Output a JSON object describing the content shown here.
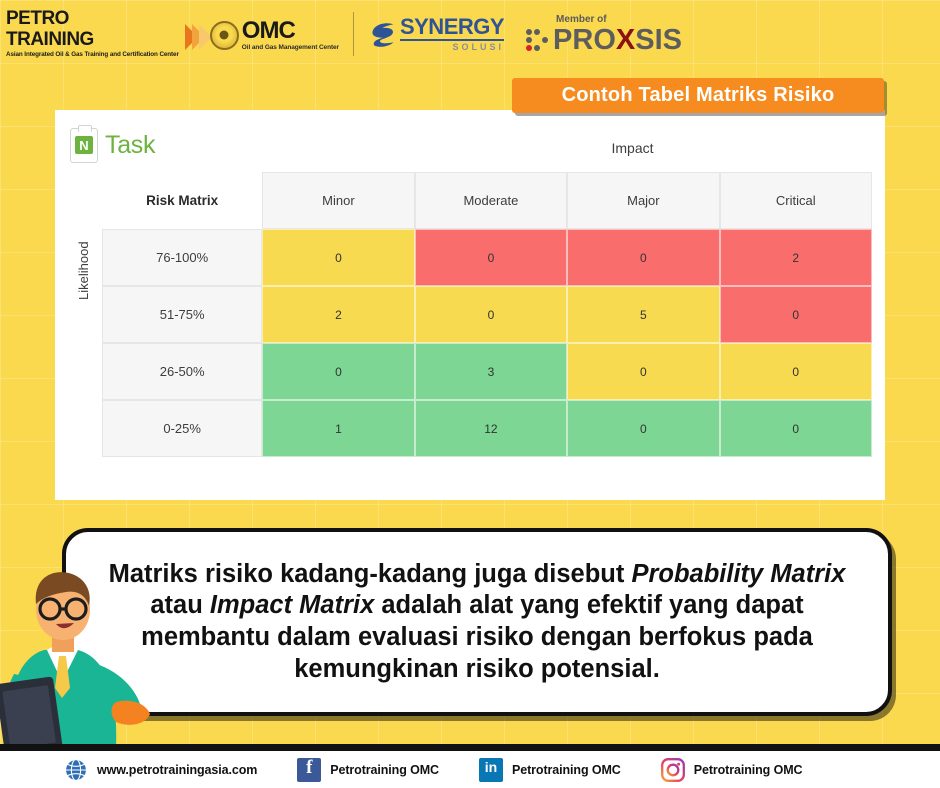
{
  "header": {
    "petro": {
      "line1": "PETRO",
      "line2": "TRAINING",
      "tagline": "Asian Integrated Oil & Gas Training and Certification Center"
    },
    "omc": {
      "name": "OMC",
      "subtitle": "Oil and Gas Management Center"
    },
    "synergy": {
      "name": "SYNERGY",
      "subtitle": "SOLUSI"
    },
    "proxsis": {
      "member_of": "Member of",
      "name_pre": "PRO",
      "name_x": "X",
      "name_post": "SIS"
    }
  },
  "title_banner": {
    "text": "Contoh Tabel Matriks Risiko",
    "bg_color": "#f68c1f",
    "text_color": "#ffffff"
  },
  "panel": {
    "task_logo": {
      "word": "Task",
      "mark": "N",
      "color": "#6cb33f"
    },
    "impact_label": "Impact",
    "likelihood_label": "Likelihood",
    "corner_label": "Risk Matrix"
  },
  "chart_data": {
    "type": "heatmap",
    "title": "Risk Matrix",
    "xlabel": "Impact",
    "ylabel": "Likelihood",
    "categories": [
      "Minor",
      "Moderate",
      "Major",
      "Critical"
    ],
    "rows": [
      "76-100%",
      "51-75%",
      "26-50%",
      "0-25%"
    ],
    "values": [
      [
        0,
        0,
        0,
        2
      ],
      [
        2,
        0,
        5,
        0
      ],
      [
        0,
        3,
        0,
        0
      ],
      [
        1,
        12,
        0,
        0
      ]
    ],
    "cell_levels": [
      [
        "yellow",
        "red",
        "red",
        "red"
      ],
      [
        "yellow",
        "yellow",
        "yellow",
        "red"
      ],
      [
        "green",
        "green",
        "yellow",
        "yellow"
      ],
      [
        "green",
        "green",
        "green",
        "green"
      ]
    ],
    "level_colors": {
      "green": "#7ed694",
      "yellow": "#f7da4f",
      "red": "#fa6d6d"
    },
    "grid": true,
    "legend": "none"
  },
  "bubble": {
    "part1": "Matriks risiko kadang-kadang juga disebut ",
    "em1": "Probability Matrix",
    "part2": " atau ",
    "em2": "Impact Matrix",
    "part3": " adalah alat yang efektif yang dapat membantu dalam evaluasi risiko dengan berfokus pada kemungkinan risiko potensial."
  },
  "footer": {
    "items": [
      {
        "icon": "globe-icon",
        "label": "www.petrotrainingasia.com"
      },
      {
        "icon": "facebook-icon",
        "label": "Petrotraining OMC"
      },
      {
        "icon": "linkedin-icon",
        "label": "Petrotraining OMC"
      },
      {
        "icon": "instagram-icon",
        "label": "Petrotraining OMC"
      }
    ]
  }
}
